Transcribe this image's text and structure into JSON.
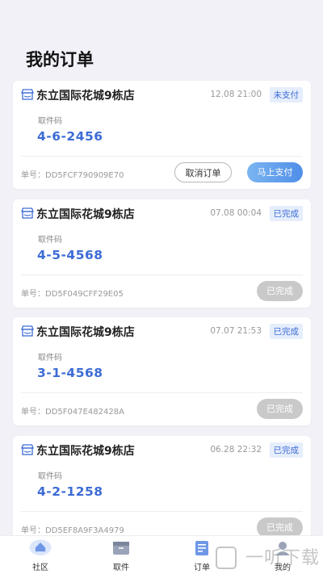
{
  "page": {
    "title": "我的订单"
  },
  "orders": [
    {
      "store": "东立国际花城9栋店",
      "time": "12.08 21:00",
      "status": "未支付",
      "code_label": "取件码",
      "code": "4-6-2456",
      "order_no": "单号：DD5FCF790909E70",
      "cancel_label": "取消订单",
      "pay_label": "马上支付"
    },
    {
      "store": "东立国际花城9栋店",
      "time": "07.08 00:04",
      "status": "已完成",
      "code_label": "取件码",
      "code": "4-5-4568",
      "order_no": "单号：DD5F049CFF29E05",
      "done_label": "已完成"
    },
    {
      "store": "东立国际花城9栋店",
      "time": "07.07 21:53",
      "status": "已完成",
      "code_label": "取件码",
      "code": "3-1-4568",
      "order_no": "单号：DD5F047E482428A",
      "done_label": "已完成"
    },
    {
      "store": "东立国际花城9栋店",
      "time": "06.28 22:32",
      "status": "已完成",
      "code_label": "取件码",
      "code": "4-2-1258",
      "order_no": "单号：DD5EF8A9F3A4979",
      "done_label": "已完成"
    }
  ],
  "tabbar": {
    "items": [
      {
        "label": "社区",
        "icon": "community-icon"
      },
      {
        "label": "取件",
        "icon": "package-icon"
      },
      {
        "label": "订单",
        "icon": "orders-icon"
      },
      {
        "label": "我的",
        "icon": "profile-icon"
      }
    ]
  },
  "watermark": {
    "text": "一听下载"
  },
  "colors": {
    "accent": "#3d6cd6",
    "badge_bg": "#e6eefc",
    "done_btn": "#c9c9c9",
    "background": "#f2f1f8"
  }
}
